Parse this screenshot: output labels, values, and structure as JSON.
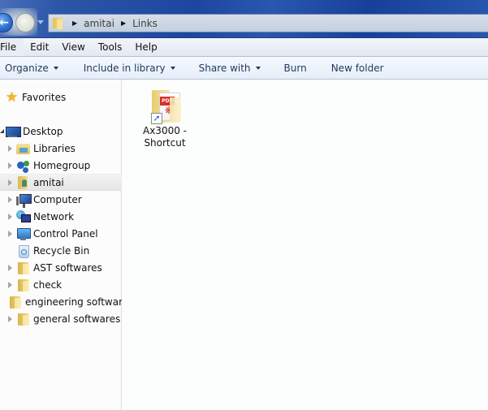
{
  "address_bar": {
    "breadcrumbs": [
      "amitai",
      "Links"
    ],
    "icons": {
      "back": "back-arrow-icon",
      "forward": "forward-arrow-icon",
      "history": "chevron-down-icon",
      "location": "folder-icon",
      "separator": "chevron-right-icon"
    }
  },
  "menu": {
    "items": [
      "File",
      "Edit",
      "View",
      "Tools",
      "Help"
    ]
  },
  "toolbar": {
    "organize": "Organize",
    "include_in_library": "Include in library",
    "share_with": "Share with",
    "burn": "Burn",
    "new_folder": "New folder"
  },
  "nav_pane": {
    "favorites": {
      "label": "Favorites",
      "icon": "star-icon"
    },
    "items": [
      {
        "label": "Desktop",
        "icon": "desktop-icon",
        "expander": "open"
      },
      {
        "label": "Libraries",
        "icon": "libraries-icon",
        "expander": "closed"
      },
      {
        "label": "Homegroup",
        "icon": "homegroup-icon",
        "expander": "closed"
      },
      {
        "label": "amitai",
        "icon": "user-folder-icon",
        "expander": "closed",
        "selected": true
      },
      {
        "label": "Computer",
        "icon": "computer-icon",
        "expander": "closed"
      },
      {
        "label": "Network",
        "icon": "network-icon",
        "expander": "closed"
      },
      {
        "label": "Control Panel",
        "icon": "control-panel-icon",
        "expander": "closed"
      },
      {
        "label": "Recycle Bin",
        "icon": "recycle-bin-icon",
        "expander": "none"
      },
      {
        "label": "AST softwares",
        "icon": "folder-icon",
        "expander": "closed"
      },
      {
        "label": "check",
        "icon": "folder-icon",
        "expander": "closed"
      },
      {
        "label": "engineering software",
        "icon": "folder-icon",
        "expander": "none"
      },
      {
        "label": "general softwares",
        "icon": "folder-icon",
        "expander": "closed"
      }
    ]
  },
  "content": {
    "files": [
      {
        "name_line1": "Ax3000 -",
        "name_line2": "Shortcut",
        "icon": "pdf-shortcut-icon",
        "badge": "PDF"
      }
    ]
  }
}
